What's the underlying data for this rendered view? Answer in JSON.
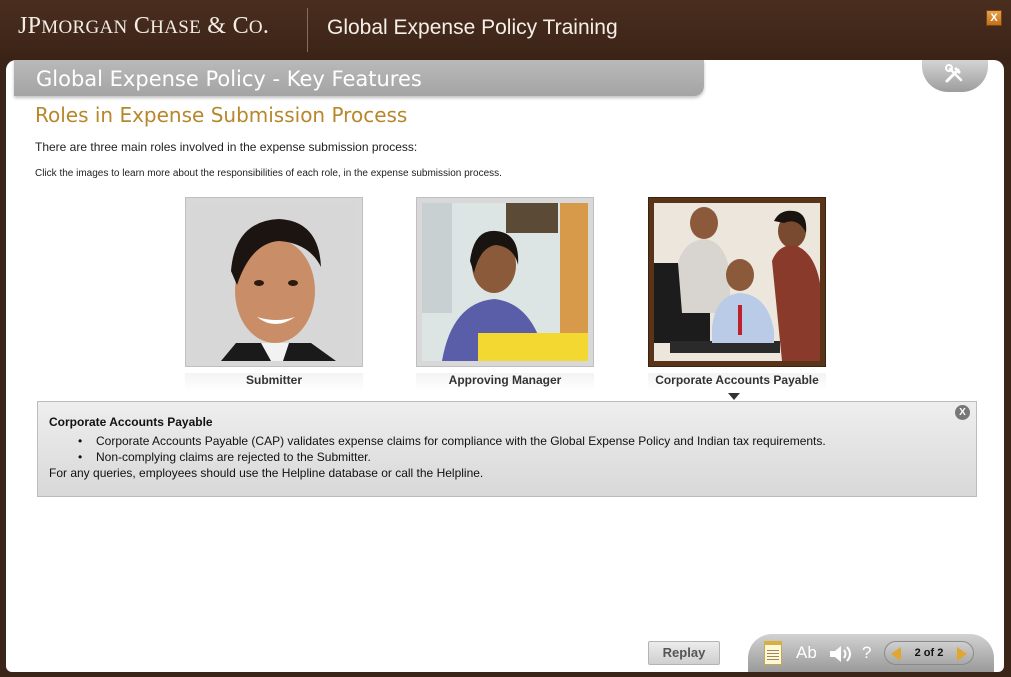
{
  "header": {
    "logo_text": "JPMorgan Chase & Co.",
    "course_title": "Global Expense Policy Training",
    "close_label": "X"
  },
  "topic": {
    "title": "Global Expense Policy - Key Features",
    "tools_icon": "tools-icon"
  },
  "content": {
    "heading": "Roles in Expense Submission Process",
    "intro": "There are three main roles involved in the expense submission process:",
    "instruction": "Click the images to learn more about the responsibilities of each role, in the expense submission process."
  },
  "roles": [
    {
      "label": "Submitter"
    },
    {
      "label": "Approving Manager"
    },
    {
      "label": "Corporate Accounts Payable",
      "selected": true
    }
  ],
  "info": {
    "title": "Corporate Accounts Payable",
    "bullets": [
      "Corporate Accounts Payable (CAP) validates expense claims for compliance with the Global Expense Policy and Indian tax requirements.",
      "Non-complying claims are rejected to the Submitter."
    ],
    "footer": "For any queries, employees should use the Helpline database or call the Helpline.",
    "close_label": "X"
  },
  "controls": {
    "replay_label": "Replay",
    "font_label": "Ab",
    "audio_icon": "speaker-icon",
    "help_label": "?",
    "page_indicator": "2 of 2"
  },
  "colors": {
    "header_bg": "#3b2418",
    "heading_gold": "#b8862b",
    "active_frame": "#5a3418",
    "nav_arrow": "#e0a630"
  }
}
